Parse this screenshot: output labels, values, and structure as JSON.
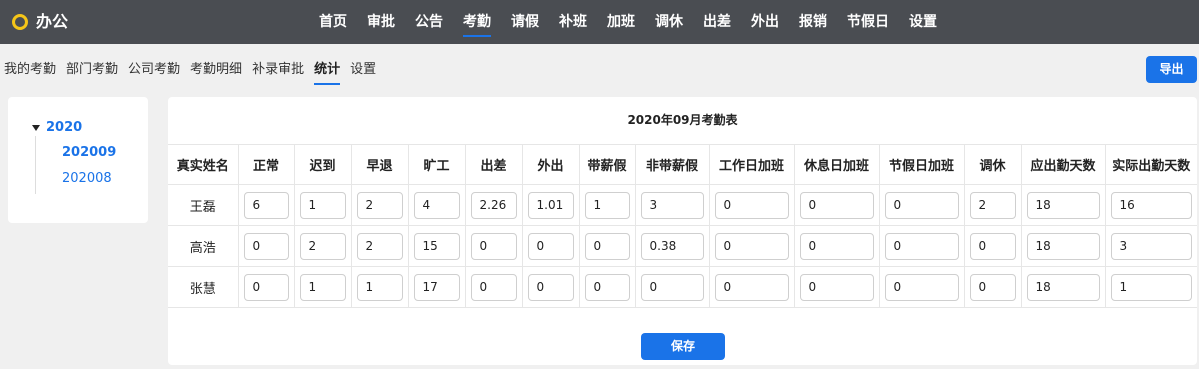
{
  "header": {
    "app_title": "办公",
    "nav": [
      "首页",
      "审批",
      "公告",
      "考勤",
      "请假",
      "补班",
      "加班",
      "调休",
      "出差",
      "外出",
      "报销",
      "节假日",
      "设置"
    ],
    "active_nav": "考勤"
  },
  "subnav": {
    "items": [
      "我的考勤",
      "部门考勤",
      "公司考勤",
      "考勤明细",
      "补录审批",
      "统计",
      "设置"
    ],
    "active": "统计"
  },
  "export_label": "导出",
  "tree": {
    "root": "2020",
    "children": [
      "202009",
      "202008"
    ],
    "selected": "202009"
  },
  "table": {
    "title": "2020年09月考勤表",
    "headers": [
      "真实姓名",
      "正常",
      "迟到",
      "早退",
      "旷工",
      "出差",
      "外出",
      "带薪假",
      "非带薪假",
      "工作日加班",
      "休息日加班",
      "节假日加班",
      "调休",
      "应出勤天数",
      "实际出勤天数"
    ],
    "rows": [
      {
        "name": "王磊",
        "values": [
          "6",
          "1",
          "2",
          "4",
          "2.26",
          "1.01",
          "1",
          "3",
          "0",
          "0",
          "0",
          "2",
          "18",
          "16"
        ]
      },
      {
        "name": "高浩",
        "values": [
          "0",
          "2",
          "2",
          "15",
          "0",
          "0",
          "0",
          "0.38",
          "0",
          "0",
          "0",
          "0",
          "18",
          "3"
        ]
      },
      {
        "name": "张慧",
        "values": [
          "0",
          "1",
          "1",
          "17",
          "0",
          "0",
          "0",
          "0",
          "0",
          "0",
          "0",
          "0",
          "18",
          "1"
        ]
      }
    ]
  },
  "save_label": "保存",
  "colors": {
    "topbar": "#4a4d52",
    "accent": "#1a73e8",
    "logo": "#f5c518"
  }
}
